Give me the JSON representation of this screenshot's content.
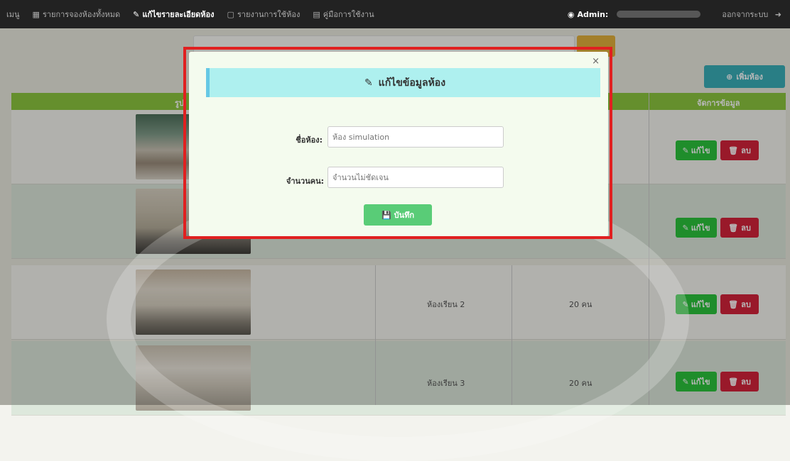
{
  "nav": {
    "menu": "เมนู",
    "items": [
      {
        "label": "รายการจองห้องทั้งหมด",
        "icon": "table-icon"
      },
      {
        "label": "แก้ไขรายละเอียดห้อง",
        "icon": "edit-icon"
      },
      {
        "label": "รายงานการใช้ห้อง",
        "icon": "document-icon"
      },
      {
        "label": "คู่มือการใช้งาน",
        "icon": "book-icon"
      }
    ],
    "admin_label": "Admin:",
    "logout": "ออกจากระบบ"
  },
  "page": {
    "add_room": "เพิ่มห้อง",
    "col_picture": "รูป",
    "col_manage": "จัดการข้อมูล",
    "rows": [
      {
        "name": "",
        "capacity": ""
      },
      {
        "name": "",
        "capacity": ""
      },
      {
        "name": "ห้องเรียน 2",
        "capacity": "20 คน"
      },
      {
        "name": "ห้องเรียน 3",
        "capacity": "20 คน"
      }
    ],
    "edit_label": "แก้ไข",
    "delete_label": "ลบ"
  },
  "modal": {
    "title": "แก้ไขข้อมูลห้อง",
    "close": "×",
    "room_name_label": "ชื่อห้อง:",
    "room_name_placeholder": "ห้อง simulation",
    "capacity_label": "จำนวนคน:",
    "capacity_placeholder": "จำนวนไม่ชัดเจน",
    "save": "บันทึก"
  },
  "colors": {
    "navbar": "#222222",
    "header_green": "#8cc63f",
    "modal_header": "#aef0ef",
    "edit_green": "#2bc43c",
    "delete_red": "#d4233b",
    "highlight": "#e02020"
  }
}
